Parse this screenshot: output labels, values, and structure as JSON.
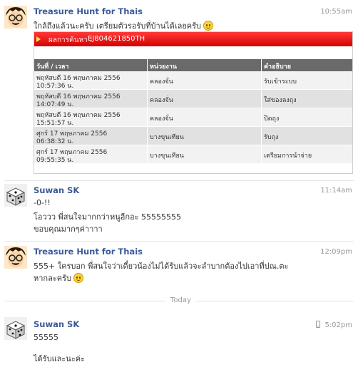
{
  "messages": [
    {
      "sender": "Treasure Hunt for Thais",
      "time": "10:55am",
      "avatar": "cartoon-face-avatar",
      "lines": [
        "ใกล้ถึงแล้วนะครับ เตรียมตัวรอรับที่บ้านได้เลยครับ"
      ],
      "attachment": {
        "result_label": "ผลการค้นหา :",
        "tracking_code": "EJ804621850TH",
        "headers": [
          "วันที่ / เวลา",
          "หน่วยงาน",
          "คำอธิบาย"
        ],
        "rows": [
          {
            "date": "พฤหัสบดี 16 พฤษภาคม 2556",
            "time": "10:57:36 น.",
            "unit": "คลองจั่น",
            "desc": "รับเข้าระบบ"
          },
          {
            "date": "พฤหัสบดี 16 พฤษภาคม 2556",
            "time": "14:07:49 น.",
            "unit": "คลองจั่น",
            "desc": "ใส่ของลงถุง"
          },
          {
            "date": "พฤหัสบดี 16 พฤษภาคม 2556",
            "time": "15:51:57 น.",
            "unit": "คลองจั่น",
            "desc": "ปิดถุง"
          },
          {
            "date": "ศุกร์ 17 พฤษภาคม 2556",
            "time": "06:38:32 น.",
            "unit": "บางขุนเทียน",
            "desc": "รับถุง"
          },
          {
            "date": "ศุกร์ 17 พฤษภาคม 2556",
            "time": "09:55:35 น.",
            "unit": "บางขุนเทียน",
            "desc": "เตรียมการนำจ่าย"
          }
        ]
      }
    },
    {
      "sender": "Suwan SK",
      "time": "11:14am",
      "avatar": "dice-avatar",
      "lines": [
        "-0-!!",
        "โอววว พี่สนใจมากกว่าหนูอีกอะ 55555555",
        "ขอบคุณมากๆค่าาาา"
      ]
    },
    {
      "sender": "Treasure Hunt for Thais",
      "time": "12:09pm",
      "avatar": "cartoon-face-avatar",
      "lines": [
        "555+ ใครบอก พี่สนใจว่าเดี๋ยวน้องไม่ได้รับแล้วจะลำบากต้องไปเอาที่ปณ.ตะ",
        "หากละครับ"
      ]
    },
    {
      "sender": "Suwan SK",
      "time": "5:02pm",
      "avatar": "dice-avatar",
      "lines": [
        "55555",
        "ได้รับและนะค่ะ"
      ]
    }
  ],
  "separator": {
    "label": "Today"
  }
}
